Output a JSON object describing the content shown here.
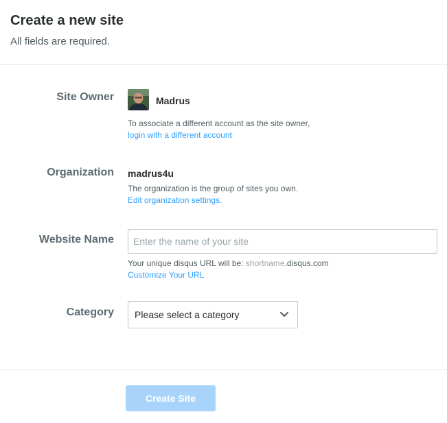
{
  "header": {
    "title": "Create a new site",
    "subtitle": "All fields are required."
  },
  "site_owner": {
    "label": "Site Owner",
    "name": "Madrus",
    "help": "To associate a different account as the site owner,",
    "link": "login with a different account"
  },
  "organization": {
    "label": "Organization",
    "name": "madrus4u",
    "help": "The organization is the group of sites you own.",
    "link": "Edit organization settings."
  },
  "website_name": {
    "label": "Website Name",
    "placeholder": "Enter the name of your site",
    "value": "",
    "url_prefix": "Your unique disqus URL will be: ",
    "url_shortname": "shortname",
    "url_suffix": ".disqus.com",
    "link": "Customize Your URL"
  },
  "category": {
    "label": "Category",
    "selected": "Please select a category"
  },
  "actions": {
    "create_label": "Create Site"
  },
  "colors": {
    "link": "#2e9fff",
    "button_disabled": "#a8d4fb",
    "label": "#5d6b72"
  }
}
